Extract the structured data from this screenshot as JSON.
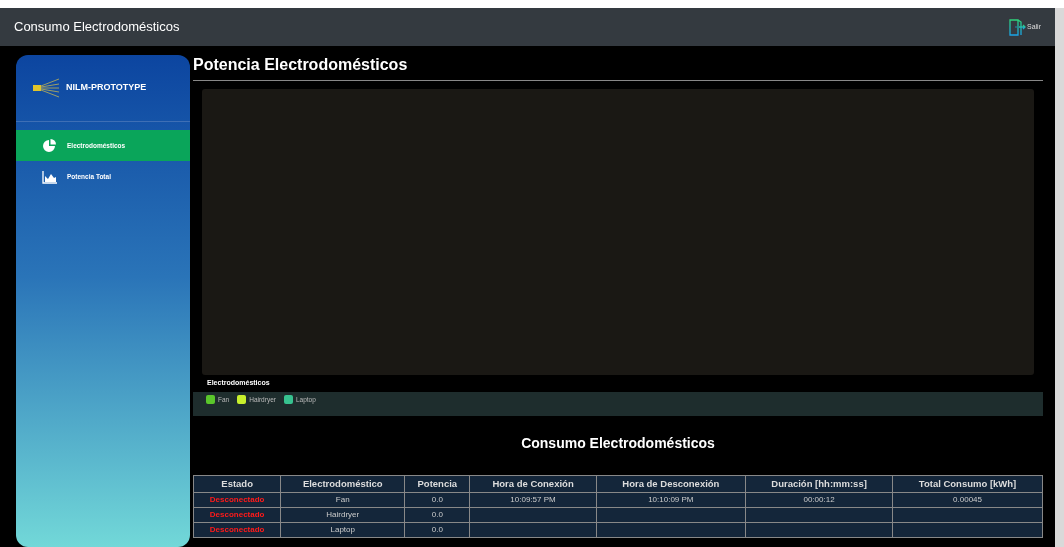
{
  "navbar": {
    "title": "Consumo Electrodomésticos",
    "logout_label": "Salir"
  },
  "sidebar": {
    "brand": "NILM-PROTOTYPE",
    "items": [
      {
        "label": "Electrodomésticos",
        "kind": "pie",
        "selected": true
      },
      {
        "label": "Potencia Total",
        "kind": "area",
        "selected": false
      }
    ]
  },
  "page_title": "Potencia Electrodomésticos",
  "legend": {
    "title": "Electrodomésticos",
    "items": [
      {
        "label": "Fan",
        "color": "#5ac62b"
      },
      {
        "label": "Hairdryer",
        "color": "#c8f02c"
      },
      {
        "label": "Laptop",
        "color": "#37c28f"
      }
    ]
  },
  "table": {
    "title": "Consumo Electrodomésticos",
    "columns": [
      "Estado",
      "Electrodoméstico",
      "Potencia",
      "Hora de Conexión",
      "Hora de Desconexión",
      "Duración [hh:mm:ss]",
      "Total Consumo [kWh]"
    ],
    "rows": [
      {
        "connected": false,
        "cells": [
          "Desconectado",
          "Fan",
          "0.0",
          "10:09:57 PM",
          "10:10:09 PM",
          "00:00:12",
          "0.00045"
        ]
      },
      {
        "connected": false,
        "cells": [
          "Desconectado",
          "Hairdryer",
          "0.0",
          "",
          "",
          "",
          ""
        ]
      },
      {
        "connected": false,
        "cells": [
          "Desconectado",
          "Laptop",
          "0.0",
          "",
          "",
          "",
          ""
        ]
      }
    ]
  }
}
